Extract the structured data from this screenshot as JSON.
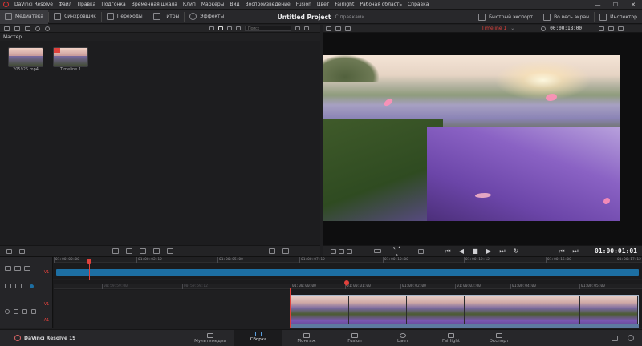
{
  "titlebar": {
    "app": "DaVinci Resolve",
    "menus": [
      "Файл",
      "Правка",
      "Подгонка",
      "Временная шкала",
      "Клип",
      "Маркеры",
      "Вид",
      "Воспроизведение",
      "Fusion",
      "Цвет",
      "Fairlight",
      "Рабочая область",
      "Справка"
    ],
    "minimize": "—",
    "maximize": "☐",
    "close": "✕"
  },
  "toolbar": {
    "media": "Медиатека",
    "sync": "Синхровщик",
    "transitions": "Переходы",
    "titles": "Титры",
    "effects": "Эффекты",
    "project_title": "Untitled Project",
    "project_state": "С правками",
    "quick_export": "Быстрый экспорт",
    "fullscreen": "Во весь экран",
    "inspector": "Инспектор"
  },
  "pool": {
    "search_placeholder": "Поиск",
    "bin": "Мастер",
    "clips": [
      {
        "name": "205925.mp4"
      },
      {
        "name": "Timeline 1"
      }
    ]
  },
  "viewer": {
    "timeline_name": "Timeline 1",
    "duration": "00:00:18:00",
    "timecode": "01:00:01:01"
  },
  "timeline_top": {
    "ticks": [
      "01:00:00:00",
      "01:00:02:12",
      "01:00:05:00",
      "01:00:07:12",
      "01:00:10:00",
      "01:00:12:12",
      "01:00:15:00",
      "01:00:17:12"
    ],
    "track": "V1"
  },
  "timeline_bottom": {
    "ticks": [
      "00:59:59:00",
      "00:59:59:12",
      "01:00:00:00",
      "01:00:01:00",
      "01:00:02:00",
      "01:00:03:00",
      "01:00:04:00",
      "01:00:05:00"
    ],
    "video_track": "V1",
    "audio_track": "A1"
  },
  "bottombar": {
    "brand": "DaVinci Resolve 19",
    "pages": [
      "Мультимедиа",
      "Сборка",
      "Монтаж",
      "Fusion",
      "Цвет",
      "Fairlight",
      "Экспорт"
    ],
    "active_page": "Сборка"
  },
  "colors": {
    "accent": "#e0413c",
    "timeline_bar": "#1d6fa3"
  }
}
